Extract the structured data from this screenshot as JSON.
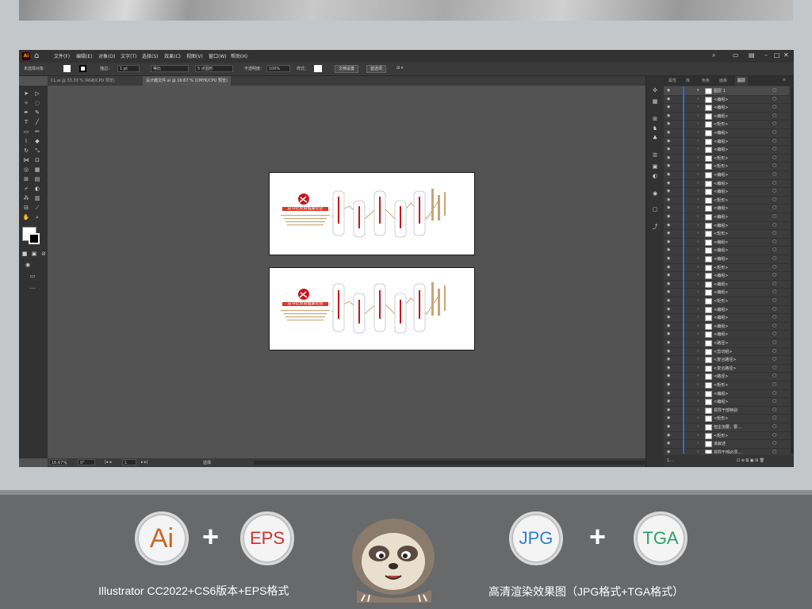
{
  "menubar": {
    "logo": "Ai",
    "items": [
      "文件(F)",
      "编辑(E)",
      "对象(O)",
      "文字(T)",
      "选择(S)",
      "效果(C)",
      "视图(V)",
      "窗口(W)",
      "帮助(H)"
    ]
  },
  "controlbar": {
    "selection": "未选择对象",
    "stroke_label": "描边：",
    "stroke_value": "1 pt",
    "line_style": "等比",
    "brush": "5 点圆形",
    "opacity_label": "不透明度：",
    "opacity_value": "100%",
    "style_label": "样式：",
    "doc_setup": "文档设置",
    "preferences": "首选项"
  },
  "tabs": [
    {
      "label": "CL.ai @ 33.33 % (RGB/CPU 预览)",
      "active": false
    },
    {
      "label": "设计趣文件.ai @ 16.67 % (CMYK/CPU 预览)",
      "active": true
    }
  ],
  "artboards": [
    {
      "headline": "总书记反腐倡廉论述"
    },
    {
      "headline": "总书记反腐倡廉论述"
    }
  ],
  "statusbar": {
    "zoom": "16.67%",
    "rotation": "0°",
    "artboard_index": "1",
    "mode": "选择"
  },
  "panel": {
    "tabs": [
      "属性",
      "库",
      "色板",
      "画板",
      "图层"
    ],
    "active_tab": "图层",
    "layer_top": "图层 1",
    "rows": [
      "<编组>",
      "<编组>",
      "<编组>",
      "<矩形>",
      "<编组>",
      "<编组>",
      "<编组>",
      "<矩形>",
      "<矩形>",
      "<编组>",
      "<编组>",
      "<编组>",
      "<矩形>",
      "<编组>",
      "<编组>",
      "<编组>",
      "<矩形>",
      "<编组>",
      "<编组>",
      "<编组>",
      "<矩形>",
      "<编组>",
      "<编组>",
      "<编组>",
      "<矩形>",
      "<编组>",
      "<编组>",
      "<编组>",
      "<编组>",
      "<路径>",
      "<剪切组>",
      "<复合路径>",
      "<复合路径>",
      "<路径>",
      "<矩形>",
      "<编组>",
      "<编组>",
      "领导干部特别",
      "<矩形>",
      "但企加要，要…",
      "<矩形>",
      "该叙述",
      "领导干部必须…"
    ],
    "footer": "1…"
  },
  "banner": {
    "badges": [
      {
        "text": "Ai",
        "color": "#c8682b"
      },
      {
        "text": "EPS",
        "color": "#d0322b"
      },
      {
        "text": "JPG",
        "color": "#2f7fd1"
      },
      {
        "text": "TGA",
        "color": "#2fa06e"
      }
    ],
    "left_caption": "Illustrator CC2022+CS6版本+EPS格式",
    "right_caption": "高清渲染效果图（JPG格式+TGA格式）"
  }
}
